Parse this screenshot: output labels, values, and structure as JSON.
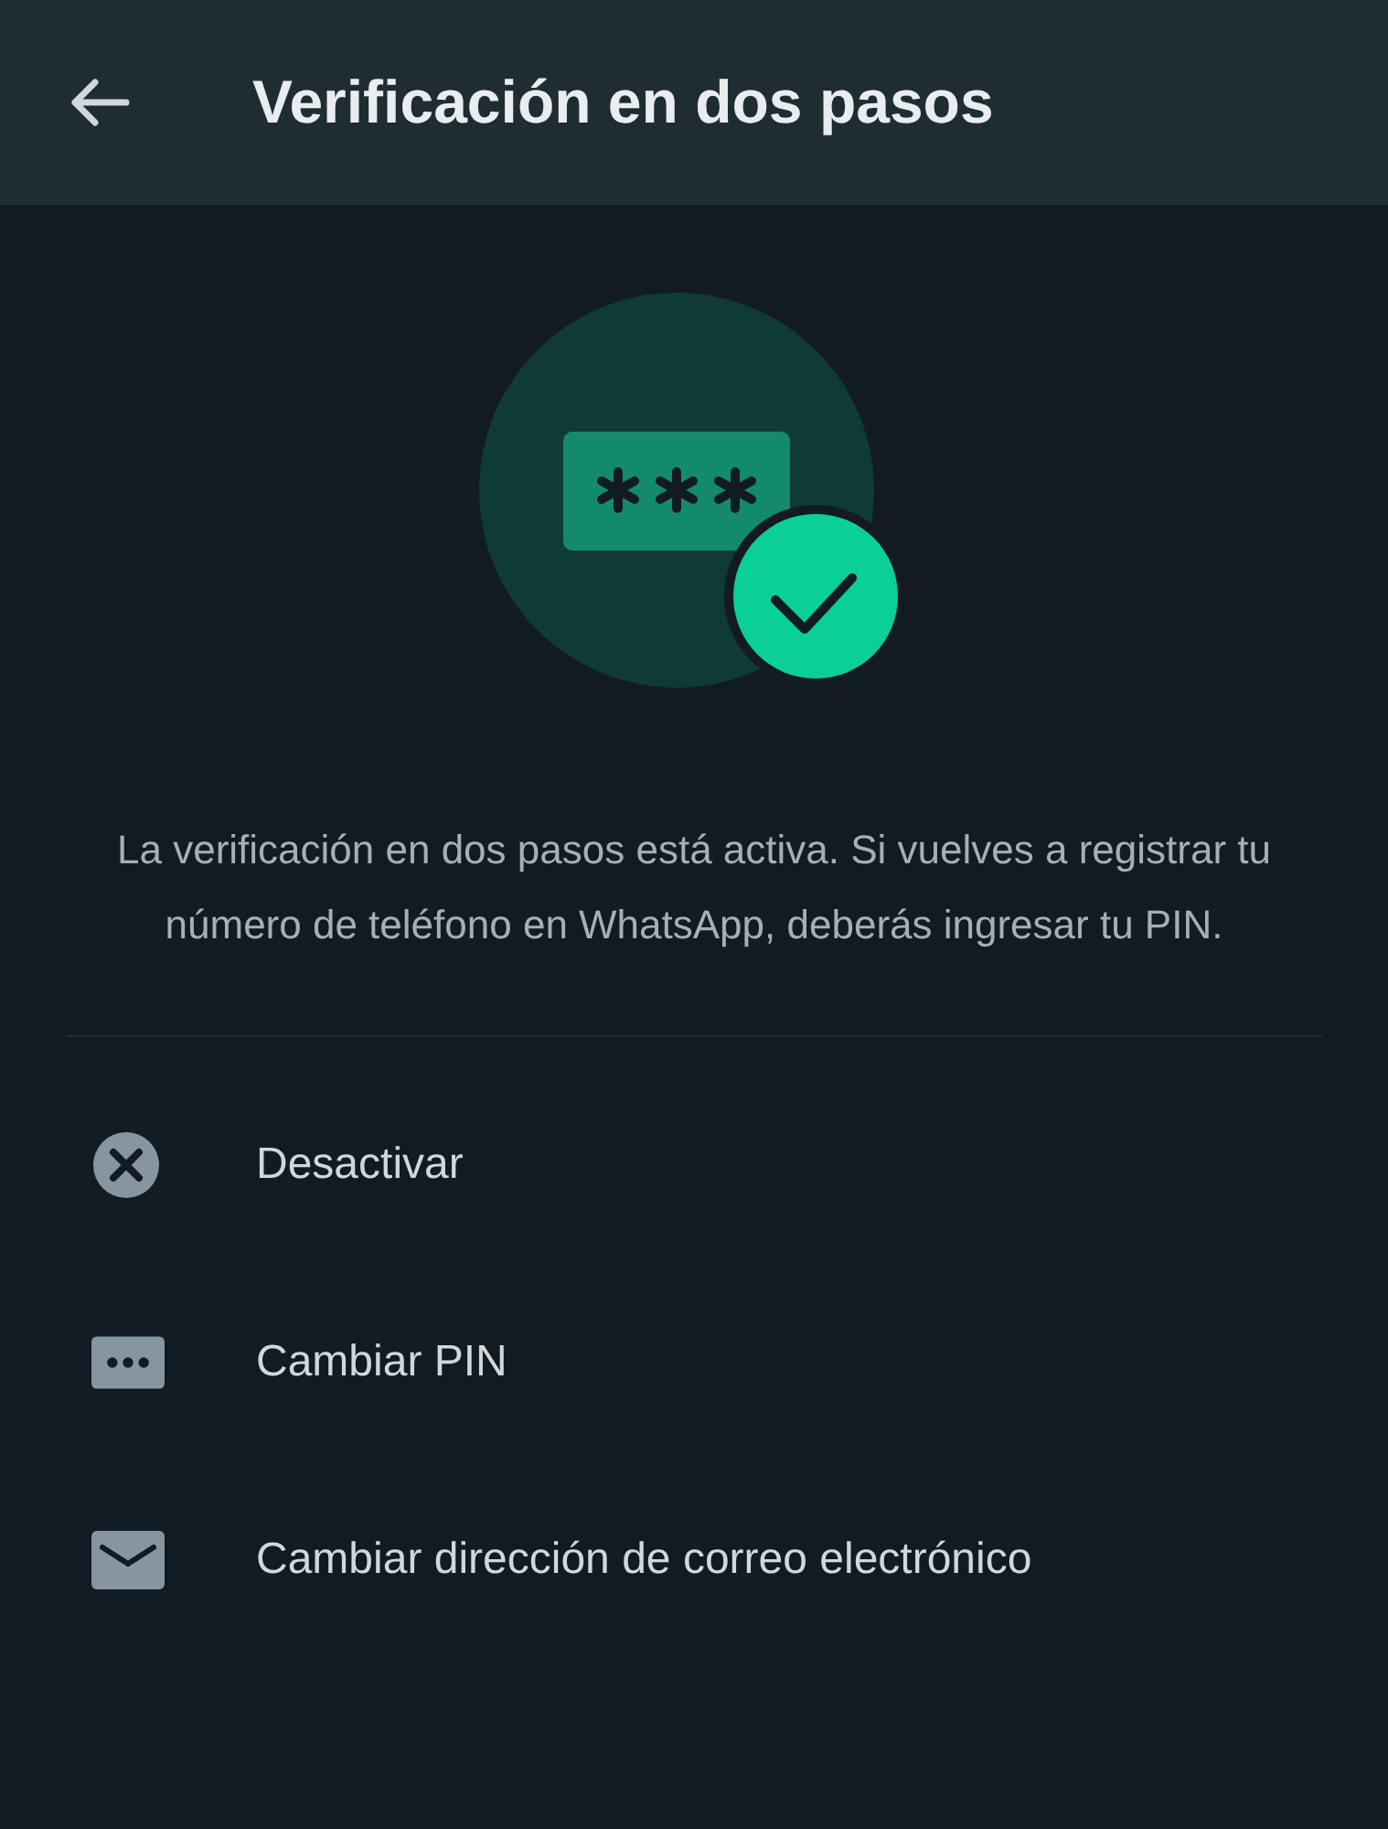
{
  "header": {
    "title": "Verificación en dos pasos"
  },
  "description": "La verificación en dos pasos está activa. Si vuelves a registrar tu número de teléfono en WhatsApp, deberás ingresar tu PIN.",
  "options": [
    {
      "kind": "disable",
      "label": "Desactivar"
    },
    {
      "kind": "pin",
      "label": "Cambiar PIN"
    },
    {
      "kind": "email",
      "label": "Cambiar dirección de correo electrónico"
    }
  ]
}
